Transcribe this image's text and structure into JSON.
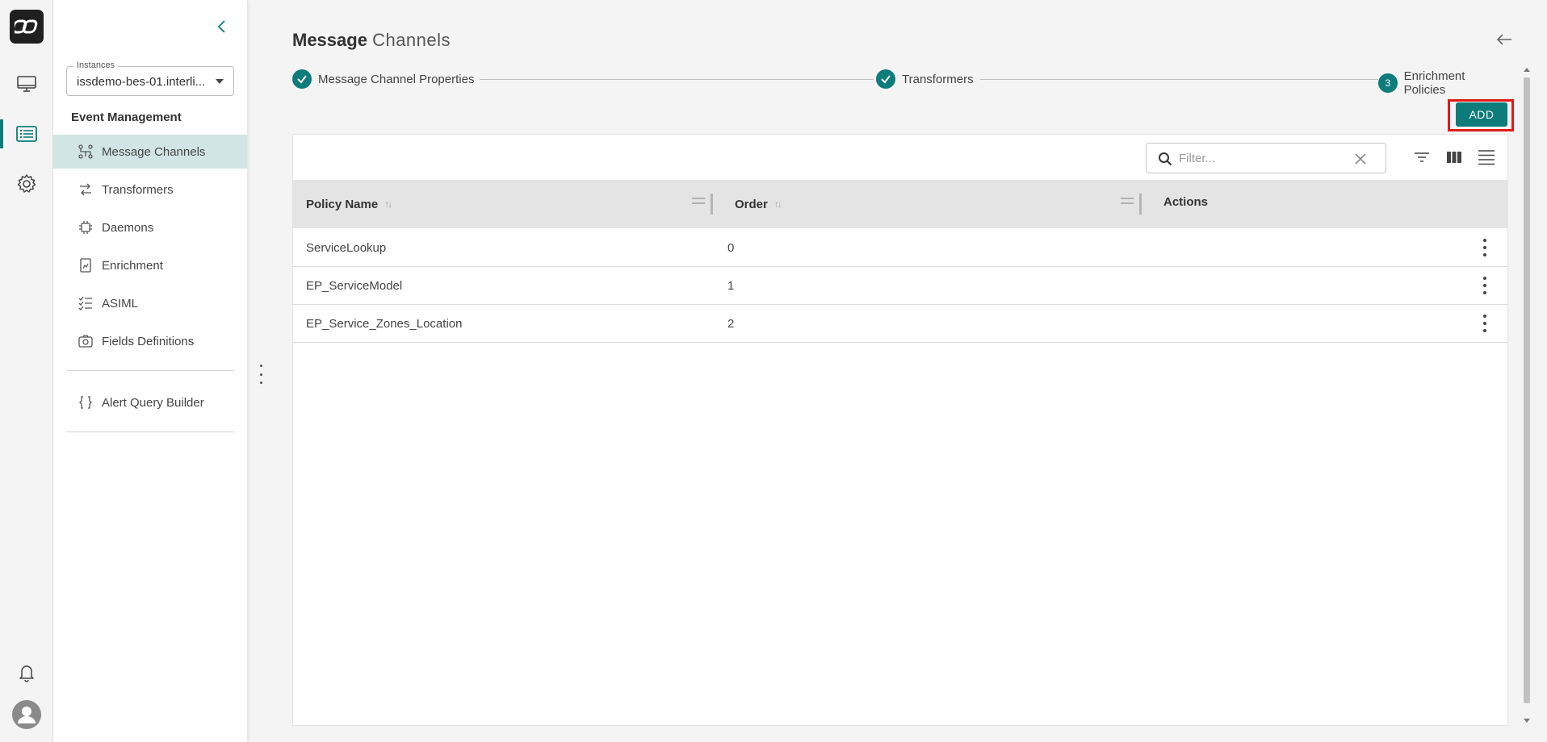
{
  "app": {
    "logo_icon": "chain-link-logo-icon",
    "accent_color": "#0e7c7b",
    "highlight_color": "#e11a1a"
  },
  "rail": {
    "items": [
      {
        "name": "monitor-icon",
        "active": false
      },
      {
        "name": "list-icon",
        "active": true
      },
      {
        "name": "gear-icon",
        "active": false
      }
    ],
    "bottom": [
      {
        "name": "bell-icon"
      },
      {
        "name": "user-avatar-icon"
      }
    ]
  },
  "nav": {
    "instances_label": "Instances",
    "instance_value": "issdemo-bes-01.interli...",
    "section_title": "Event Management",
    "items": [
      {
        "label": "Message Channels",
        "icon": "channels-icon",
        "active": true
      },
      {
        "label": "Transformers",
        "icon": "transformers-icon",
        "active": false
      },
      {
        "label": "Daemons",
        "icon": "chip-icon",
        "active": false
      },
      {
        "label": "Enrichment",
        "icon": "document-chart-icon",
        "active": false
      },
      {
        "label": "ASIML",
        "icon": "checklist-icon",
        "active": false
      },
      {
        "label": "Fields Definitions",
        "icon": "camera-icon",
        "active": false
      }
    ],
    "secondary_items": [
      {
        "label": "Alert Query Builder",
        "icon": "braces-icon"
      }
    ]
  },
  "page": {
    "title_bold": "Message",
    "title_light": "Channels"
  },
  "stepper": {
    "steps": [
      {
        "label": "Message Channel Properties",
        "state": "done",
        "marker": ""
      },
      {
        "label": "Transformers",
        "state": "done",
        "marker": ""
      },
      {
        "label": "Enrichment Policies",
        "state": "current",
        "marker": "3"
      }
    ]
  },
  "toolbar": {
    "add_label": "ADD",
    "filter_placeholder": "Filter..."
  },
  "table": {
    "columns": [
      "Policy Name",
      "Order",
      "Actions"
    ],
    "rows": [
      {
        "name": "ServiceLookup",
        "order": "0"
      },
      {
        "name": "EP_ServiceModel",
        "order": "1"
      },
      {
        "name": "EP_Service_Zones_Location",
        "order": "2"
      }
    ]
  }
}
